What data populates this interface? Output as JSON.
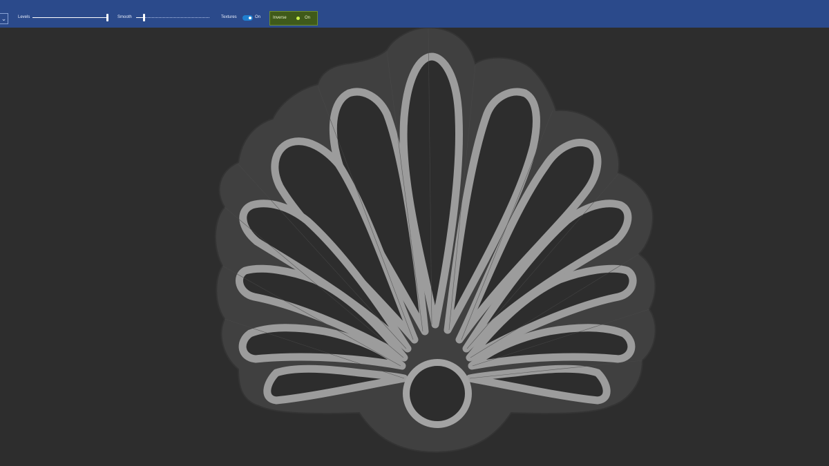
{
  "toolbar": {
    "dropdown_icon": "chevron-down-icon",
    "levels": {
      "label": "Levels",
      "value": 1.0
    },
    "smooth": {
      "label": "Smooth",
      "value": 0.1
    },
    "textures": {
      "label": "Textures",
      "state": "On"
    },
    "inverse": {
      "label": "Inverse",
      "state": "On"
    }
  },
  "colors": {
    "toolbar_bg": "#2b4a8b",
    "viewport_bg": "#2d2d2d",
    "toggle_on": "#1f7fcf",
    "inverse_accent": "#c9f04a"
  }
}
